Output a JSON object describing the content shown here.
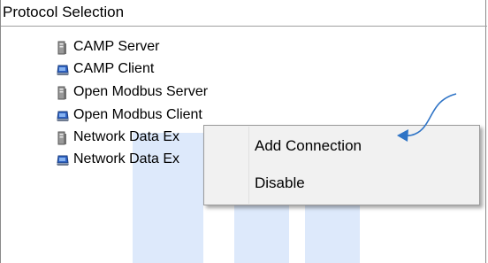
{
  "panel": {
    "header_title": "Protocol Selection"
  },
  "tree": {
    "items": [
      {
        "label": "CAMP Server",
        "icon": "server-icon"
      },
      {
        "label": "CAMP Client",
        "icon": "client-icon"
      },
      {
        "label": "Open Modbus Server",
        "icon": "server-icon"
      },
      {
        "label": "Open Modbus Client",
        "icon": "client-icon"
      },
      {
        "label": "Network Data Ex",
        "icon": "server-icon"
      },
      {
        "label": "Network Data Ex",
        "icon": "client-icon"
      }
    ]
  },
  "context_menu": {
    "items": [
      {
        "label": "Add Connection"
      },
      {
        "label": "Disable"
      }
    ]
  },
  "colors": {
    "watermark": "#dde9fb",
    "arrow": "#2f74c6"
  }
}
